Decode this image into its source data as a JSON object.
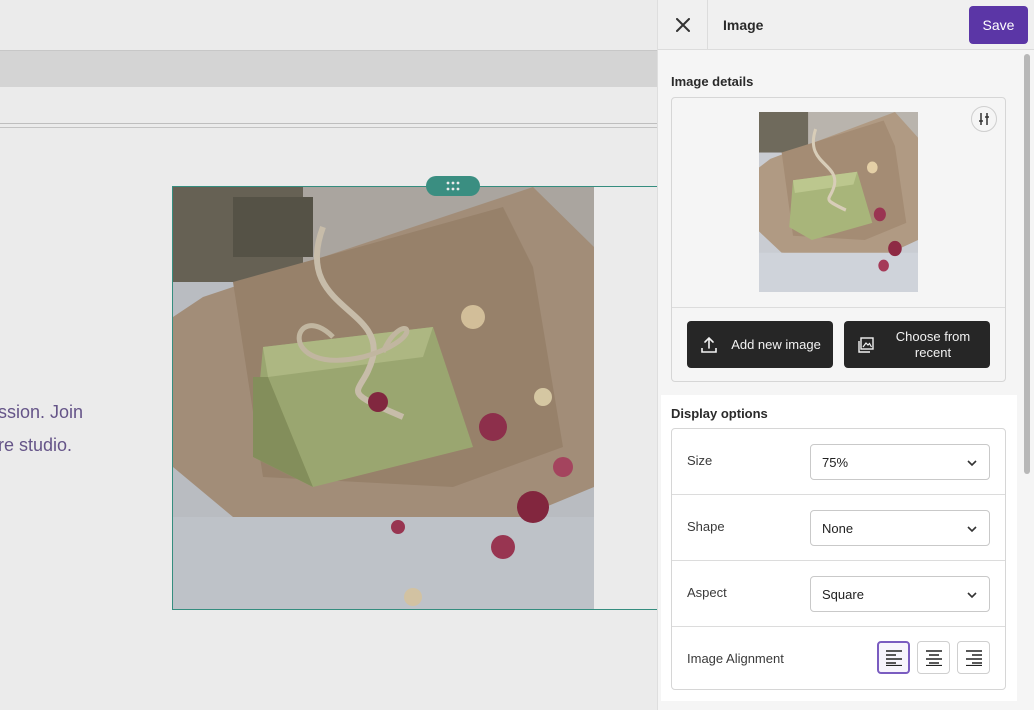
{
  "editor": {
    "body_text_lines": [
      "ssion. Join",
      "re studio."
    ]
  },
  "panel": {
    "title": "Image",
    "save_label": "Save",
    "image_details_heading": "Image details",
    "add_new_image_label": "Add new image",
    "choose_recent_label": "Choose from recent",
    "display_options_heading": "Display options",
    "options": [
      {
        "label": "Size",
        "value": "75%"
      },
      {
        "label": "Shape",
        "value": "None"
      },
      {
        "label": "Aspect",
        "value": "Square"
      }
    ],
    "alignment_label": "Image Alignment",
    "alignment_options": [
      "left",
      "center",
      "right"
    ],
    "alignment_selected": "left"
  },
  "colors": {
    "accent": "#5b36a6",
    "selection_frame": "#3a9a8a",
    "body_text": "#6e5c94"
  },
  "icons": [
    "close-icon",
    "drag-grip-icon",
    "adjust-sliders-icon",
    "upload-icon",
    "gallery-icon",
    "chevron-down-icon",
    "align-left-icon",
    "align-center-icon",
    "align-right-icon"
  ]
}
